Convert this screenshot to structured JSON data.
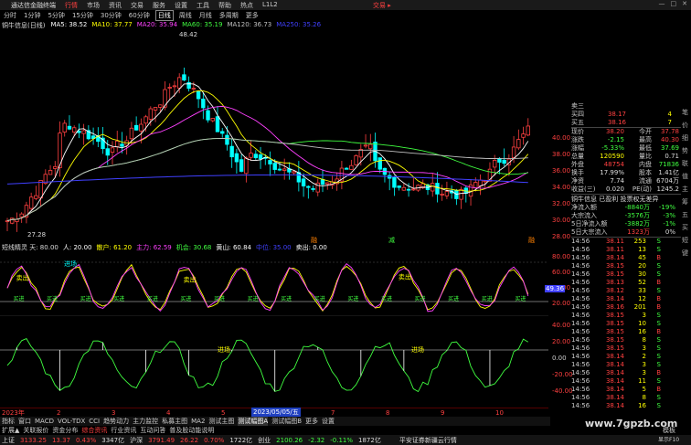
{
  "titlebar": {
    "app": "通达信金融终端",
    "menu": [
      "行情",
      "市场",
      "资讯",
      "交易",
      "服务",
      "设置",
      "工具",
      "帮助",
      "热点",
      "L1L2"
    ],
    "active_menu": "行情",
    "trade": "交易 ▸",
    "win_buttons": [
      "—",
      "□",
      "✕"
    ]
  },
  "periods": [
    "分时",
    "1分钟",
    "5分钟",
    "15分钟",
    "30分钟",
    "60分钟",
    "日线",
    "周线",
    "月线",
    "多周期",
    "更多"
  ],
  "selected_period": "日线",
  "ma": {
    "stock": "铜牛信息(日线)",
    "items": [
      {
        "label": "MA5: 38.52",
        "color": "#ffffff"
      },
      {
        "label": "MA10: 37.77",
        "color": "#ffff00"
      },
      {
        "label": "MA20: 35.94",
        "color": "#ff40ff"
      },
      {
        "label": "MA60: 35.19",
        "color": "#40ff40"
      },
      {
        "label": "MA120: 36.73",
        "color": "#c0c0c0"
      },
      {
        "label": "MA250: 35.26",
        "color": "#4040ff"
      }
    ]
  },
  "chart_labels": {
    "high": "48.42",
    "low": "27.28"
  },
  "events": [
    "融",
    "减",
    "融"
  ],
  "price_axis": [
    "40.00",
    "38.00",
    "36.00",
    "34.00",
    "32.00",
    "30.00",
    "28.00"
  ],
  "ind1": {
    "title": "短线精灵 天: 80.00",
    "items": [
      {
        "label": "人: 20.00",
        "color": "#ffffff"
      },
      {
        "label": "散户: 61.20",
        "color": "#ffff00"
      },
      {
        "label": "主力: 62.59",
        "color": "#ff40ff"
      },
      {
        "label": "机会: 30.68",
        "color": "#40ff40"
      },
      {
        "label": "黄山: 60.84",
        "color": "#ffffff"
      },
      {
        "label": "中位: 35.00",
        "color": "#4040ff"
      },
      {
        "label": "卖出: 0.00",
        "color": "#ffffff"
      }
    ],
    "sell_label": "卖出",
    "buy_label": "买进",
    "entry_label": "进场",
    "axis": [
      "80.00",
      "60.00",
      "40.00",
      "20.00"
    ],
    "current": "49.36"
  },
  "ind2": {
    "axis": [
      "40.00",
      "20.00",
      "0.00",
      "-20.00",
      "-40.00"
    ],
    "entry_label": "进场"
  },
  "xaxis": {
    "dates": [
      "2023年",
      "2",
      "3",
      "4",
      "5",
      "6",
      "7",
      "8",
      "9",
      "10"
    ],
    "cursor": "2023/05/05/五"
  },
  "tabs1": {
    "items": [
      "指标",
      "窗口",
      "MACD",
      "VOL-TDX",
      "CCI",
      "趋势动力",
      "主力监控",
      "私募主图",
      "MA2",
      "测试主图",
      "测试幅图A",
      "测试幅图B",
      "更多",
      "设置"
    ],
    "selected": "测试幅图A"
  },
  "tabs2": {
    "items": [
      "扩展▲",
      "关联报价",
      "资金分布",
      "综合资讯",
      "行业资讯",
      "互动问答",
      "普及股动能说明"
    ]
  },
  "orderbook": [
    {
      "name": "卖三",
      "price": "",
      "vol": ""
    },
    {
      "name": "买四",
      "price": "38.17",
      "vol": "4"
    },
    {
      "name": "买五",
      "price": "38.16",
      "vol": "7"
    }
  ],
  "quote": [
    {
      "k1": "现价",
      "v1": "38.20",
      "c1": "red",
      "k2": "今开",
      "v2": "37.78",
      "c2": "red"
    },
    {
      "k1": "涨跌",
      "v1": "-2.15",
      "c1": "grn",
      "k2": "最高",
      "v2": "40.30",
      "c2": "red"
    },
    {
      "k1": "涨幅",
      "v1": "-5.33%",
      "c1": "grn",
      "k2": "最低",
      "v2": "37.69",
      "c2": "grn"
    },
    {
      "k1": "总量",
      "v1": "120590",
      "c1": "yel",
      "k2": "量比",
      "v2": "0.71",
      "c2": "wht"
    },
    {
      "k1": "外盘",
      "v1": "48754",
      "c1": "red",
      "k2": "内盘",
      "v2": "71836",
      "c2": "grn"
    },
    {
      "k1": "换手",
      "v1": "17.99%",
      "c1": "wht",
      "k2": "股本",
      "v2": "1.41亿",
      "c2": "wht"
    },
    {
      "k1": "净资",
      "v1": "7.74",
      "c1": "wht",
      "k2": "流通",
      "v2": "6704万",
      "c2": "wht"
    },
    {
      "k1": "收益(三)",
      "v1": "0.020",
      "c1": "wht",
      "k2": "PE(动)",
      "v2": "1245.2",
      "c2": "wht"
    }
  ],
  "notice": "铜牛信息 已盈利 投票权无差异",
  "flows": [
    {
      "k": "净流入额",
      "v": "-8840万",
      "p": "-19%"
    },
    {
      "k": "大宗流入",
      "v": "-3576万",
      "p": "-3%"
    },
    {
      "k": "5日净流入额",
      "v": "-3882万",
      "p": "-1%"
    },
    {
      "k": "5日大宗流入",
      "v": "1323万",
      "p": "0%"
    }
  ],
  "ticks": [
    {
      "t": "14:56",
      "p": "38.11",
      "v": "253",
      "s": "S",
      "sc": "grn"
    },
    {
      "t": "14:56",
      "p": "38.11",
      "v": "13",
      "s": "S",
      "sc": "grn"
    },
    {
      "t": "14:56",
      "p": "38.14",
      "v": "45",
      "s": "B",
      "sc": "red"
    },
    {
      "t": "14:56",
      "p": "38.15",
      "v": "20",
      "s": "S",
      "sc": "grn"
    },
    {
      "t": "14:56",
      "p": "38.15",
      "v": "30",
      "s": "S",
      "sc": "grn"
    },
    {
      "t": "14:56",
      "p": "38.13",
      "v": "52",
      "s": "B",
      "sc": "red"
    },
    {
      "t": "14:56",
      "p": "38.12",
      "v": "33",
      "s": "S",
      "sc": "grn"
    },
    {
      "t": "14:56",
      "p": "38.14",
      "v": "12",
      "s": "B",
      "sc": "red"
    },
    {
      "t": "14:56",
      "p": "38.16",
      "v": "201",
      "s": "B",
      "sc": "red"
    },
    {
      "t": "14:56",
      "p": "38.15",
      "v": "3",
      "s": "S",
      "sc": "grn"
    },
    {
      "t": "14:56",
      "p": "38.15",
      "v": "10",
      "s": "S",
      "sc": "grn"
    },
    {
      "t": "14:56",
      "p": "38.15",
      "v": "16",
      "s": "B",
      "sc": "red"
    },
    {
      "t": "14:56",
      "p": "38.15",
      "v": "8",
      "s": "S",
      "sc": "grn"
    },
    {
      "t": "14:56",
      "p": "38.15",
      "v": "3",
      "s": "S",
      "sc": "grn"
    },
    {
      "t": "14:56",
      "p": "38.14",
      "v": "2",
      "s": "S",
      "sc": "grn"
    },
    {
      "t": "14:56",
      "p": "38.14",
      "v": "3",
      "s": "S",
      "sc": "grn"
    },
    {
      "t": "14:56",
      "p": "38.14",
      "v": "3",
      "s": "B",
      "sc": "red"
    },
    {
      "t": "14:56",
      "p": "38.14",
      "v": "11",
      "s": "S",
      "sc": "grn"
    },
    {
      "t": "14:56",
      "p": "38.14",
      "v": "5",
      "s": "B",
      "sc": "red"
    },
    {
      "t": "14:56",
      "p": "38.14",
      "v": "8",
      "s": "S",
      "sc": "grn"
    },
    {
      "t": "14:56",
      "p": "38.14",
      "v": "16",
      "s": "S",
      "sc": "grn"
    }
  ],
  "right_tabs": [
    "笔",
    "价",
    "细",
    "势",
    "联",
    "值",
    "主",
    "筹",
    "五",
    "买",
    "短",
    "键"
  ],
  "status": {
    "items": [
      {
        "label": "上证",
        "c": "wht"
      },
      {
        "label": "3133.25",
        "c": "red"
      },
      {
        "label": "13.37",
        "c": "red"
      },
      {
        "label": "0.43%",
        "c": "red"
      },
      {
        "label": "3347亿",
        "c": "wht"
      },
      {
        "label": "沪深",
        "c": "wht"
      },
      {
        "label": "3791.49",
        "c": "red"
      },
      {
        "label": "26.22",
        "c": "red"
      },
      {
        "label": "0.70%",
        "c": "red"
      },
      {
        "label": "1722亿",
        "c": "wht"
      },
      {
        "label": "创业",
        "c": "wht"
      },
      {
        "label": "2100.26",
        "c": "grn"
      },
      {
        "label": "-2.32",
        "c": "grn"
      },
      {
        "label": "-0.11%",
        "c": "grn"
      },
      {
        "label": "1872亿",
        "c": "wht"
      }
    ],
    "broker": "平安证券新疆云行情",
    "watermark": "www.7gpzb.com"
  },
  "side_text": {
    "model": "模板",
    "vendor": "显示F10"
  }
}
